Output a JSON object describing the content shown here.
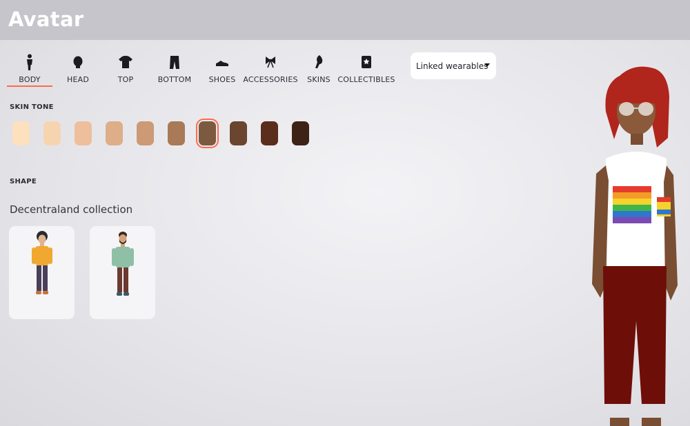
{
  "header": {
    "title": "Avatar"
  },
  "tabs": [
    {
      "label": "BODY",
      "icon": "body-icon",
      "active": true
    },
    {
      "label": "HEAD",
      "icon": "head-icon",
      "active": false
    },
    {
      "label": "TOP",
      "icon": "shirt-icon",
      "active": false
    },
    {
      "label": "BOTTOM",
      "icon": "pants-icon",
      "active": false
    },
    {
      "label": "SHOES",
      "icon": "shoe-icon",
      "active": false
    },
    {
      "label": "ACCESSORIES",
      "icon": "bow-icon",
      "active": false
    },
    {
      "label": "SKINS",
      "icon": "skin-icon",
      "active": false
    },
    {
      "label": "COLLECTIBLES",
      "icon": "collectible-icon",
      "active": false
    }
  ],
  "filter": {
    "selected": "Linked wearables"
  },
  "skin_tone": {
    "label": "SKIN TONE",
    "colors": [
      "#fde0bd",
      "#f7d4b0",
      "#eebf9c",
      "#ddae88",
      "#cc9a74",
      "#a87a58",
      "#7c5a40",
      "#6a4530",
      "#5a2d1c",
      "#3e2216"
    ],
    "selected_index": 6
  },
  "shape": {
    "label": "SHAPE",
    "collection_title": "Decentraland collection",
    "options": [
      {
        "id": "body-shape-female",
        "selected": false
      },
      {
        "id": "body-shape-male",
        "selected": false
      }
    ]
  },
  "colors": {
    "accent": "#ff6b4a",
    "header_bg": "#c6c5cb"
  }
}
